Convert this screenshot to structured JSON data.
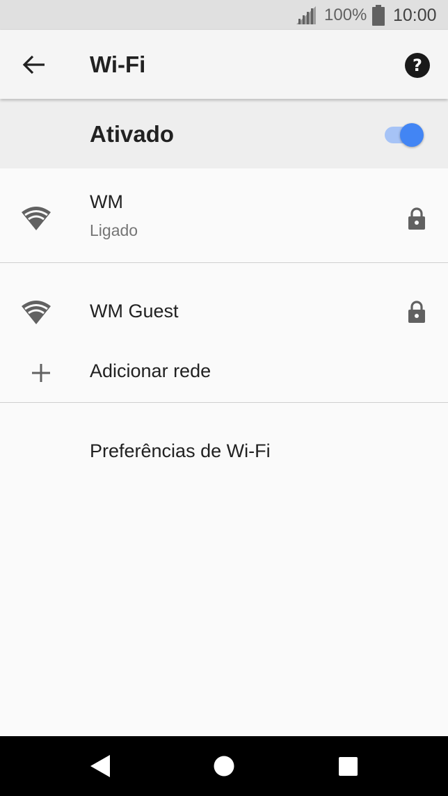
{
  "status_bar": {
    "battery_percent": "100%",
    "time": "10:00",
    "icons": [
      "signal-icon",
      "battery-icon"
    ]
  },
  "app_bar": {
    "title": "Wi-Fi",
    "back_icon": "arrow-back-icon",
    "help_icon": "help-circle-icon"
  },
  "master_switch": {
    "label": "Ativado",
    "state": "on",
    "accent_color": "#4285f4",
    "track_color": "#a6c3f6"
  },
  "networks": [
    {
      "name": "WM",
      "status": "Ligado",
      "icon": "wifi-signal-icon",
      "secured": true,
      "lock_icon": "lock-icon"
    },
    {
      "name": "WM Guest",
      "status": "",
      "icon": "wifi-signal-icon",
      "secured": true,
      "lock_icon": "lock-icon"
    }
  ],
  "add_network": {
    "label": "Adicionar rede",
    "icon": "plus-icon"
  },
  "preferences": {
    "label": "Preferências de Wi-Fi"
  },
  "nav_bar": {
    "buttons": [
      "back-triangle-icon",
      "home-circle-icon",
      "recents-square-icon"
    ]
  }
}
